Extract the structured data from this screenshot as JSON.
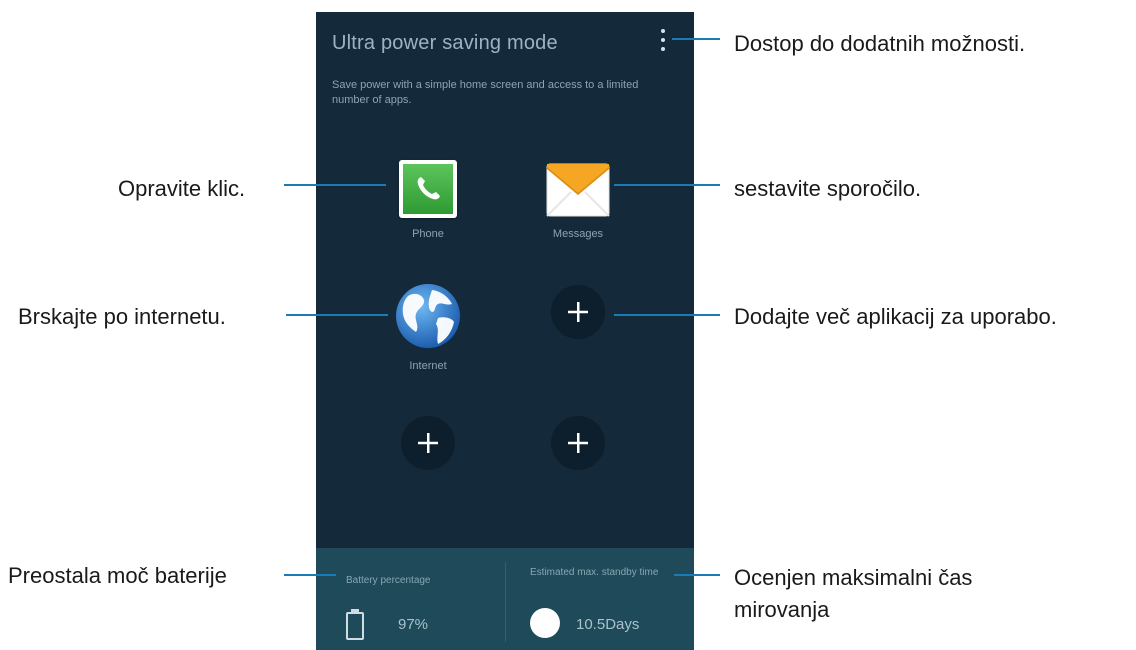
{
  "screen": {
    "title": "Ultra power saving mode",
    "description": "Save power with a simple home screen and access to a limited number of apps.",
    "apps": [
      {
        "label": "Phone",
        "icon": "phone-icon"
      },
      {
        "label": "Messages",
        "icon": "envelope-icon"
      },
      {
        "label": "Internet",
        "icon": "globe-icon"
      }
    ],
    "battery": {
      "label": "Battery percentage",
      "value": "97%"
    },
    "standby": {
      "label": "Estimated max. standby time",
      "value": "10.5Days"
    }
  },
  "callouts": {
    "more_options": "Dostop do dodatnih možnosti.",
    "phone": "Opravite klic.",
    "messages": "sestavite sporočilo.",
    "internet": "Brskajte po internetu.",
    "add_apps": "Dodajte več aplikacij za uporabo.",
    "battery": "Preostala moč baterije",
    "standby_line1": "Ocenjen maksimalni čas",
    "standby_line2": "mirovanja"
  },
  "colors": {
    "screen_bg": "#14293a",
    "bottom_bar": "#1e4a5a",
    "callout_line": "#1a7bb5"
  }
}
